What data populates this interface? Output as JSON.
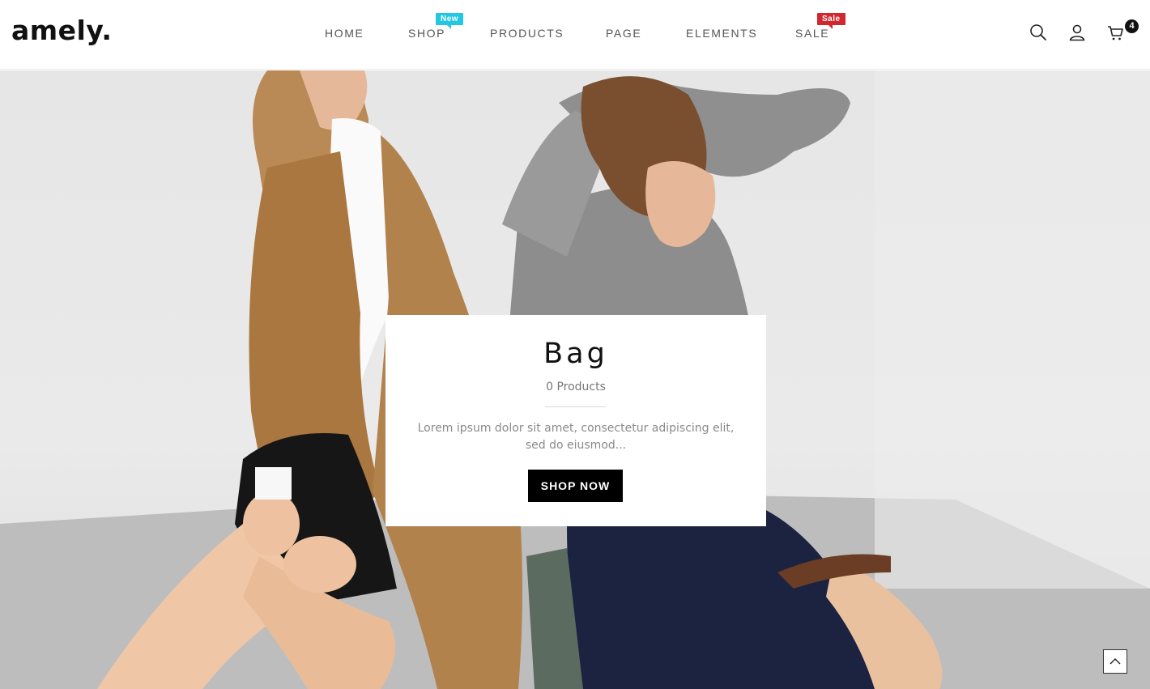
{
  "brand": {
    "logo": "amely."
  },
  "nav": {
    "items": [
      {
        "label": "HOME"
      },
      {
        "label": "SHOP",
        "badge": "New"
      },
      {
        "label": "PRODUCTS"
      },
      {
        "label": "PAGE"
      },
      {
        "label": "ELEMENTS"
      },
      {
        "label": "SALE",
        "badge": "Sale"
      }
    ],
    "badge_colors": {
      "new": "#23c7e3",
      "sale": "#d0282e"
    }
  },
  "header_icons": [
    {
      "icon": "search-icon"
    },
    {
      "icon": "user-icon"
    },
    {
      "icon": "cart-icon",
      "count": "4"
    }
  ],
  "hero": {
    "card": {
      "title": "Bag",
      "count": "0 Products",
      "description": "Lorem ipsum dolor sit amet, consectetur adipiscing elit, sed do eiusmod...",
      "button": "SHOP NOW"
    }
  },
  "scroll_top": {
    "icon": "chevron-up-icon"
  }
}
